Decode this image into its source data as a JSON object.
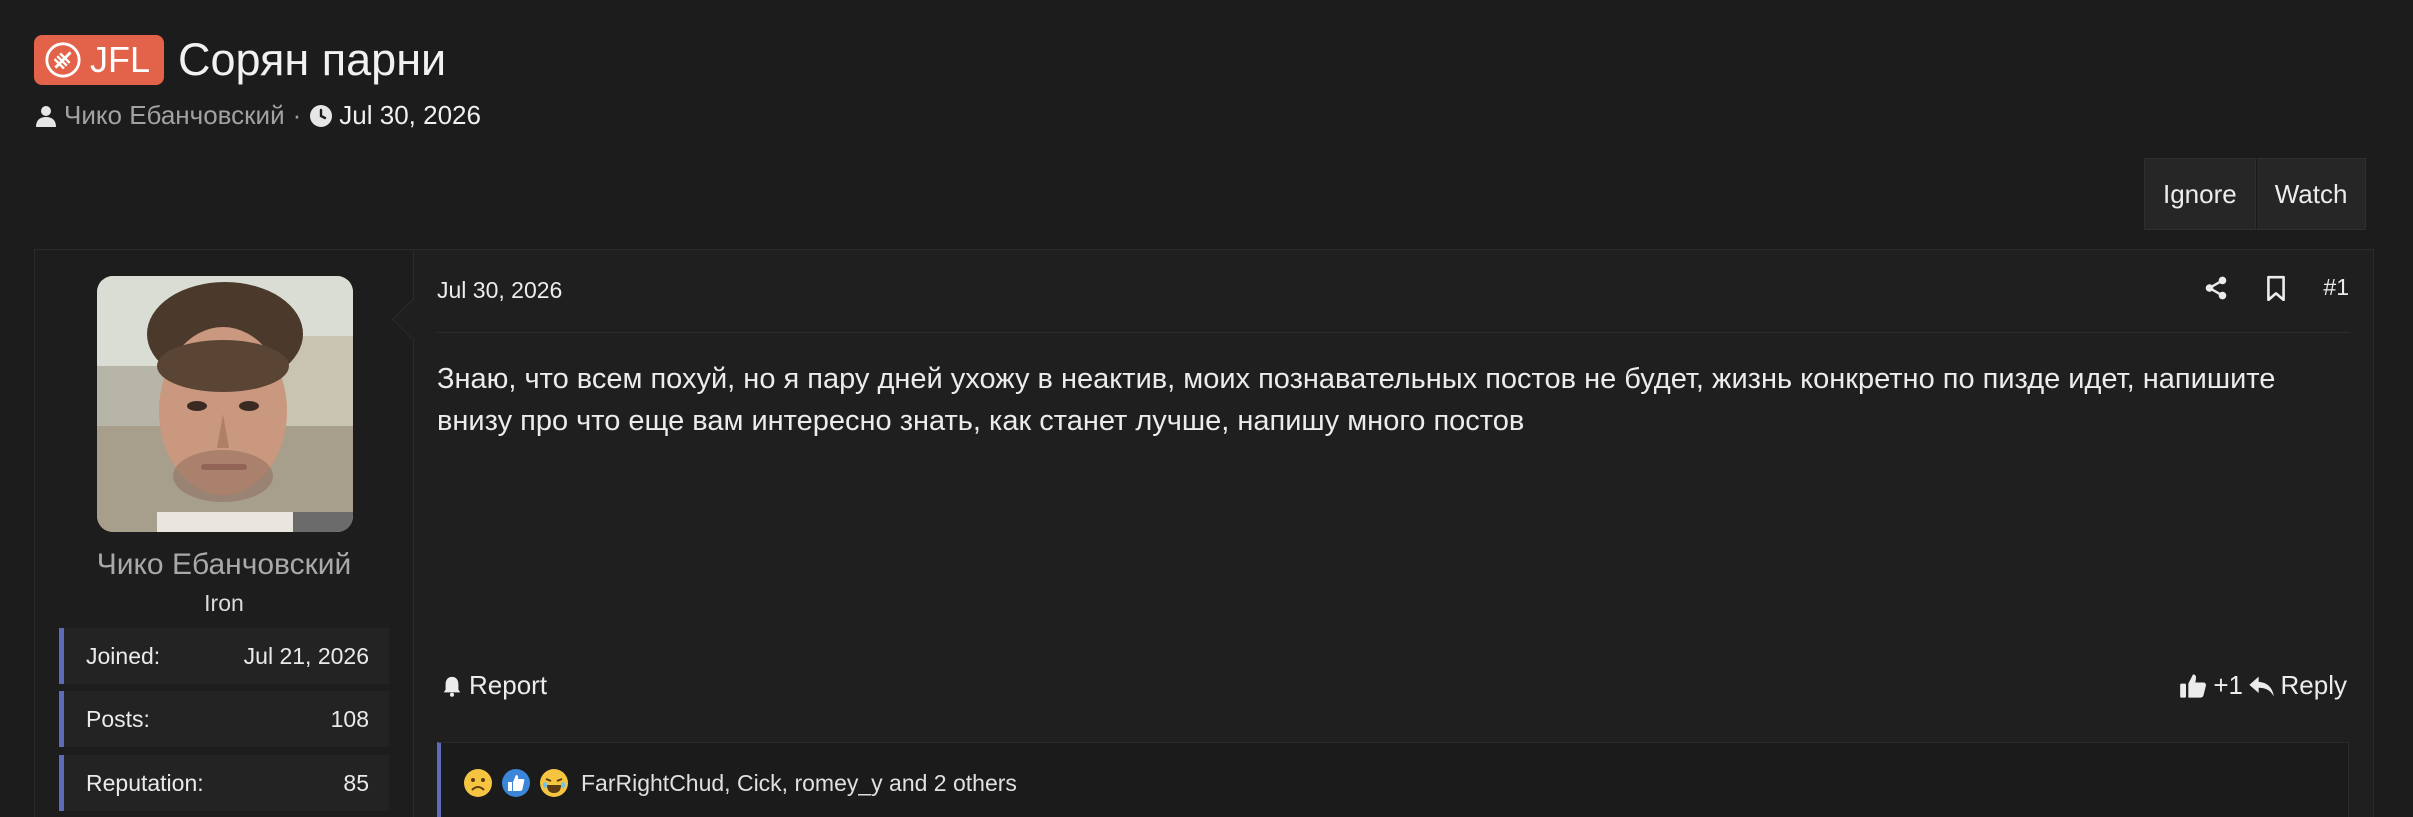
{
  "thread": {
    "prefix": "JFL",
    "title": "Сорян парни",
    "author": "Чико Ебанчовский",
    "separator": "·",
    "date": "Jul 30, 2026"
  },
  "buttons": {
    "ignore": "Ignore",
    "watch": "Watch"
  },
  "user": {
    "name": "Чико Ебанчовский",
    "title": "Iron",
    "stats": [
      {
        "label": "Joined:",
        "value": "Jul 21, 2026"
      },
      {
        "label": "Posts:",
        "value": "108"
      },
      {
        "label": "Reputation:",
        "value": "85"
      }
    ]
  },
  "post": {
    "date": "Jul 30, 2026",
    "number": "#1",
    "body": "Знаю, что всем похуй, но я пару дней ухожу в неактив, моих познавательных постов не будет, жизнь конкретно по пизде идет, напишите внизу про что еще вам интересно знать, как станет лучше, напишу много постов",
    "report_label": "Report",
    "like_label": "+1",
    "reply_label": "Reply",
    "reactions": {
      "icons": [
        "sad-face-icon",
        "thumbs-up-icon",
        "laughing-face-icon"
      ],
      "users": "FarRightChud, Cick, romey_y and 2 others"
    }
  },
  "colors": {
    "prefix": "#e2624a",
    "accent_bar": "#5d6bb8",
    "background": "#1c1c1c"
  }
}
